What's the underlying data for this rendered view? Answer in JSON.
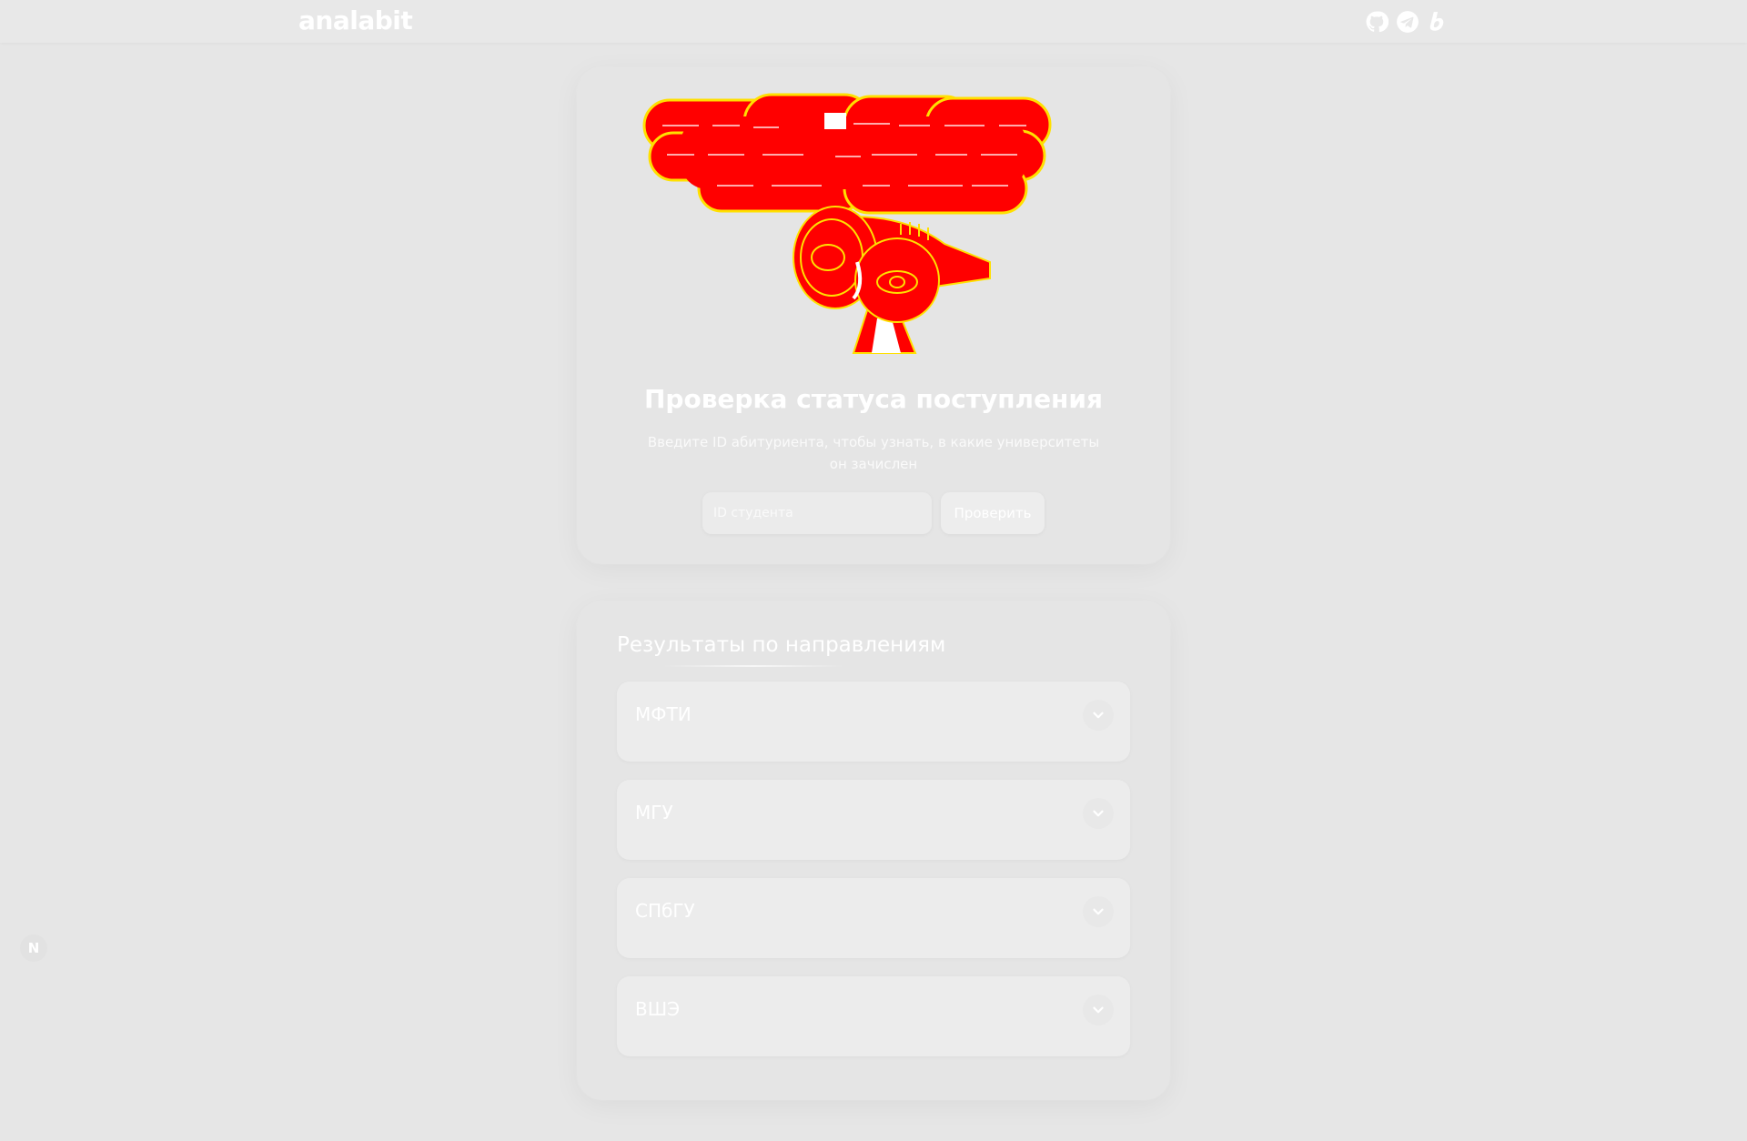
{
  "header": {
    "logo": "analabit",
    "social_icons": [
      "github-icon",
      "telegram-icon",
      "blog-icon"
    ]
  },
  "hero": {
    "title": "Проверка статуса поступления",
    "subtitle": "Введите ID абитуриента, чтобы узнать, в какие университеты он зачислен",
    "input_placeholder": "ID студента",
    "input_value": "",
    "button_label": "Проверить"
  },
  "results": {
    "title": "Результаты по направлениям",
    "universities": [
      {
        "name": "МФТИ"
      },
      {
        "name": "МГУ"
      },
      {
        "name": "СПбГУ"
      },
      {
        "name": "ВШЭ"
      }
    ]
  },
  "floating_badge": {
    "label": "N"
  },
  "colors": {
    "background": "#e6e6e6",
    "text": "#ffffff",
    "hero_art": "#ff0000",
    "hero_art_outline": "#ffee00"
  }
}
